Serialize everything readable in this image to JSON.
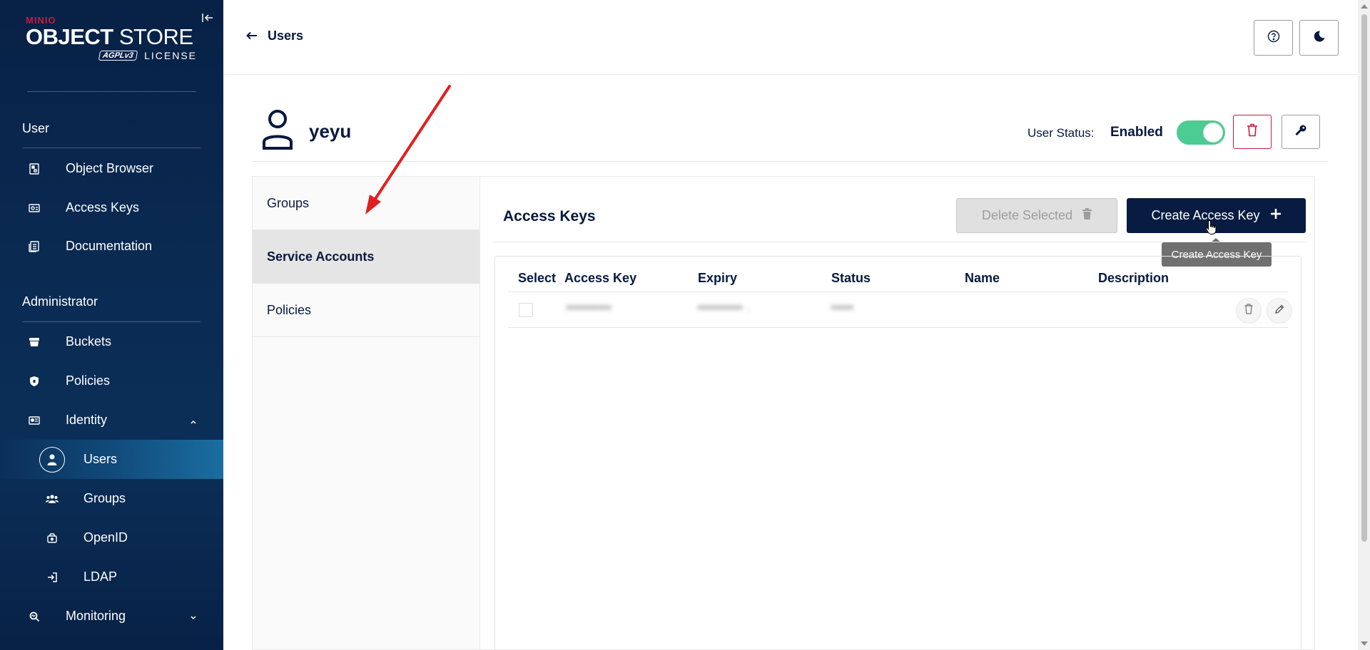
{
  "sidebar": {
    "logo": {
      "brand": "MINIO",
      "product_bold": "OBJECT",
      "product_light": "STORE",
      "license_badge": "AGPLv3",
      "license_text": "LICENSE"
    },
    "sections": [
      {
        "title": "User"
      },
      {
        "title": "Administrator"
      }
    ],
    "user_items": [
      {
        "label": "Object Browser",
        "icon": "object-browser-icon"
      },
      {
        "label": "Access Keys",
        "icon": "access-keys-icon"
      },
      {
        "label": "Documentation",
        "icon": "documentation-icon"
      }
    ],
    "admin_items": [
      {
        "label": "Buckets",
        "icon": "bucket-icon"
      },
      {
        "label": "Policies",
        "icon": "policy-icon"
      },
      {
        "label": "Identity",
        "icon": "identity-icon"
      },
      {
        "label": "Users",
        "icon": "user-icon"
      },
      {
        "label": "Groups",
        "icon": "groups-icon"
      },
      {
        "label": "OpenID",
        "icon": "openid-icon"
      },
      {
        "label": "LDAP",
        "icon": "ldap-icon"
      },
      {
        "label": "Monitoring",
        "icon": "monitoring-icon"
      }
    ]
  },
  "topbar": {
    "back_label": "Users"
  },
  "user": {
    "name": "yeyu",
    "status_label": "User Status:",
    "status_value": "Enabled",
    "enabled": true
  },
  "tabs": [
    {
      "label": "Groups",
      "active": false
    },
    {
      "label": "Service Accounts",
      "active": true
    },
    {
      "label": "Policies",
      "active": false
    }
  ],
  "panel": {
    "title": "Access Keys",
    "delete_selected_label": "Delete Selected",
    "create_label": "Create Access Key",
    "tooltip": "Create Access Key",
    "columns": [
      "Select",
      "Access Key",
      "Expiry",
      "Status",
      "Name",
      "Description"
    ],
    "rows": [
      {
        "access_key": "▪▪▪▪▪▪▪▪▪▪",
        "expiry": "▪▪▪▪▪▪▪▪▪▪ .",
        "status": "▪▪▪▪▪",
        "name": "",
        "description": ""
      }
    ]
  },
  "colors": {
    "sidebar_bg": "#082146",
    "primary": "#081c42",
    "toggle_on": "#4ccb92",
    "danger": "#c51c3f",
    "annotation_arrow": "#e02020"
  }
}
